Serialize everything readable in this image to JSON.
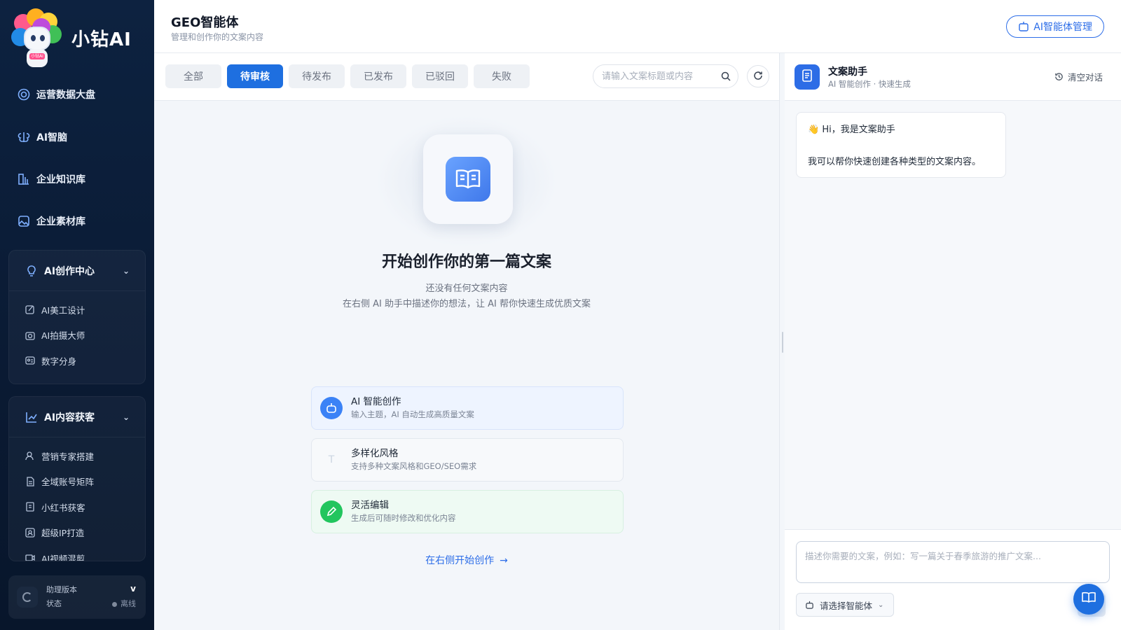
{
  "brand": {
    "name": "小钻AI",
    "badge": "小钻AI"
  },
  "sidebar": {
    "items": [
      {
        "label": "运营数据大盘",
        "icon": "dashboard-icon"
      },
      {
        "label": "AI智脑",
        "icon": "brain-icon"
      },
      {
        "label": "企业知识库",
        "icon": "knowledge-base-icon"
      },
      {
        "label": "企业素材库",
        "icon": "image-library-icon"
      }
    ],
    "groups": [
      {
        "label": "AI创作中心",
        "icon": "lightbulb-icon",
        "expanded": true,
        "children": [
          {
            "label": "AI美工设计",
            "icon": "design-icon"
          },
          {
            "label": "AI拍摄大师",
            "icon": "camera-icon"
          },
          {
            "label": "数字分身",
            "icon": "id-card-icon"
          }
        ]
      },
      {
        "label": "AI内容获客",
        "icon": "chart-line-icon",
        "expanded": true,
        "children": [
          {
            "label": "营销专家搭建",
            "icon": "user-icon"
          },
          {
            "label": "全域账号矩阵",
            "icon": "document-icon"
          },
          {
            "label": "小红书获客",
            "icon": "ai-doc-icon"
          },
          {
            "label": "超级IP打造",
            "icon": "portrait-icon"
          },
          {
            "label": "AI视频混剪",
            "icon": "video-icon"
          }
        ]
      }
    ],
    "status": {
      "version_label": "助理版本",
      "version_value": "v",
      "state_label": "状态",
      "state_value": "离线"
    }
  },
  "header": {
    "title": "GEO智能体",
    "subtitle": "管理和创作你的文案内容",
    "manage_button": "AI智能体管理"
  },
  "tabs": [
    {
      "label": "全部",
      "active": false
    },
    {
      "label": "待审核",
      "active": true
    },
    {
      "label": "待发布",
      "active": false
    },
    {
      "label": "已发布",
      "active": false
    },
    {
      "label": "已驳回",
      "active": false
    },
    {
      "label": "失败",
      "active": false
    }
  ],
  "search": {
    "placeholder": "请输入文案标题或内容",
    "value": ""
  },
  "empty_state": {
    "title": "开始创作你的第一篇文案",
    "line1": "还没有任何文案内容",
    "line2": "在右侧 AI 助手中描述你的想法，让 AI 帮你快速生成优质文案",
    "features": [
      {
        "title": "AI 智能创作",
        "desc": "输入主题，AI 自动生成高质量文案",
        "icon": "robot-icon",
        "color": "#3b82f6"
      },
      {
        "title": "多样化风格",
        "desc": "支持多种文案风格和GEO/SEO需求",
        "icon": "text-icon",
        "color": "#cbd5e1"
      },
      {
        "title": "灵活编辑",
        "desc": "生成后可随时修改和优化内容",
        "icon": "pencil-icon",
        "color": "#22c55e"
      }
    ],
    "cta": "在右侧开始创作"
  },
  "chat": {
    "assistant_name": "文案助手",
    "assistant_tag": "AI 智能创作 · 快速生成",
    "clear_label": "清空对话",
    "greeting_emoji": "👋",
    "greeting": "Hi，我是文案助手",
    "intro": "我可以帮你快速创建各种类型的文案内容。",
    "input_placeholder": "描述你需要的文案，例如：写一篇关于春季旅游的推广文案...",
    "input_value": "",
    "agent_select": "请选择智能体"
  },
  "colors": {
    "primary": "#1e6fe0",
    "sidebar_bg": "#0d2240",
    "success": "#22c55e"
  }
}
